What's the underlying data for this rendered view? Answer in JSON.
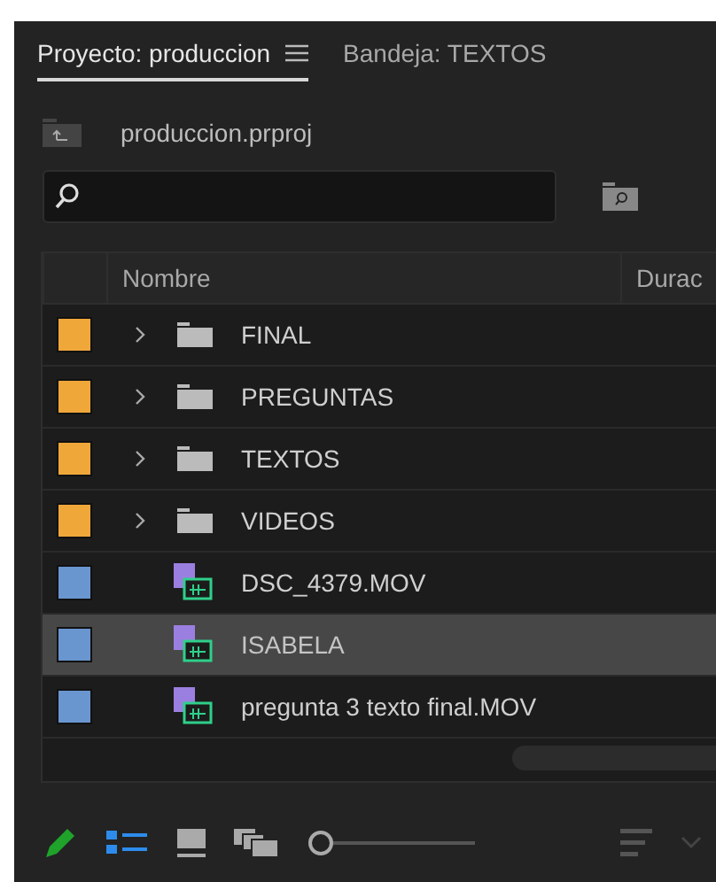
{
  "tabs": [
    {
      "label": "Proyecto: produccion",
      "selected": true,
      "menu": true
    },
    {
      "label": "Bandeja: TEXTOS",
      "selected": false,
      "menu": false
    }
  ],
  "project": {
    "file": "produccion.prproj"
  },
  "table": {
    "columns": [
      "Nombre",
      "Durac"
    ],
    "rows": [
      {
        "kind": "folder",
        "name": "FINAL",
        "color": "#f0a73a",
        "expanded": false,
        "selected": false
      },
      {
        "kind": "folder",
        "name": "PREGUNTAS",
        "color": "#f0a73a",
        "expanded": false,
        "selected": false
      },
      {
        "kind": "folder",
        "name": "TEXTOS",
        "color": "#f0a73a",
        "expanded": false,
        "selected": false
      },
      {
        "kind": "folder",
        "name": "VIDEOS",
        "color": "#f0a73a",
        "expanded": false,
        "selected": false
      },
      {
        "kind": "clip",
        "name": "DSC_4379.MOV",
        "color": "#6a96d0",
        "selected": false
      },
      {
        "kind": "clip",
        "name": "ISABELA",
        "color": "#6a96d0",
        "selected": true
      },
      {
        "kind": "clip",
        "name": "pregunta 3 texto final.MOV",
        "color": "#6a96d0",
        "selected": false
      }
    ]
  },
  "toolbar": {
    "list_view": {
      "selected": true
    },
    "icon_view": {
      "selected": false
    },
    "zoom": {
      "level": 0.0
    }
  }
}
